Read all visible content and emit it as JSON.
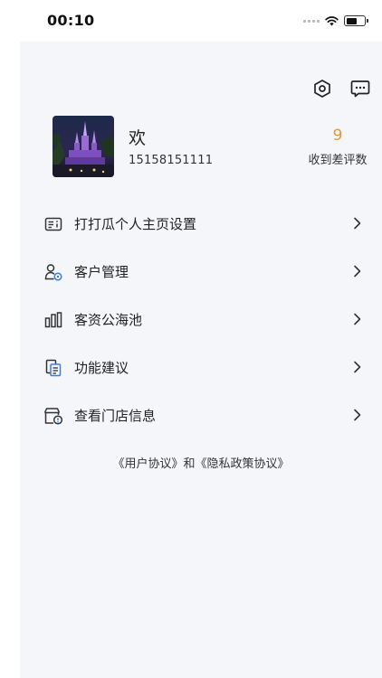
{
  "status_bar": {
    "time": "00:10",
    "battery_level": 0.6
  },
  "header": {
    "settings_icon": "settings-hex-icon",
    "message_icon": "message-chat-icon"
  },
  "profile": {
    "name": "欢",
    "phone": "15158151111",
    "avatar": "castle-night-photo",
    "review_count": "9",
    "review_label": "收到差评数"
  },
  "menu": {
    "items": [
      {
        "label": "打打瓜个人主页设置",
        "icon": "id-card-icon"
      },
      {
        "label": "客户管理",
        "icon": "user-settings-icon"
      },
      {
        "label": "客资公海池",
        "icon": "bar-chart-icon"
      },
      {
        "label": "功能建议",
        "icon": "document-icon"
      },
      {
        "label": "查看门店信息",
        "icon": "store-info-icon"
      }
    ]
  },
  "footer": {
    "user_agreement": "《用户协议》",
    "connector": "和",
    "privacy_agreement": "《隐私政策协议》"
  },
  "colors": {
    "background": "#f5f6fa",
    "accent": "#f2932b",
    "text": "#222222"
  }
}
